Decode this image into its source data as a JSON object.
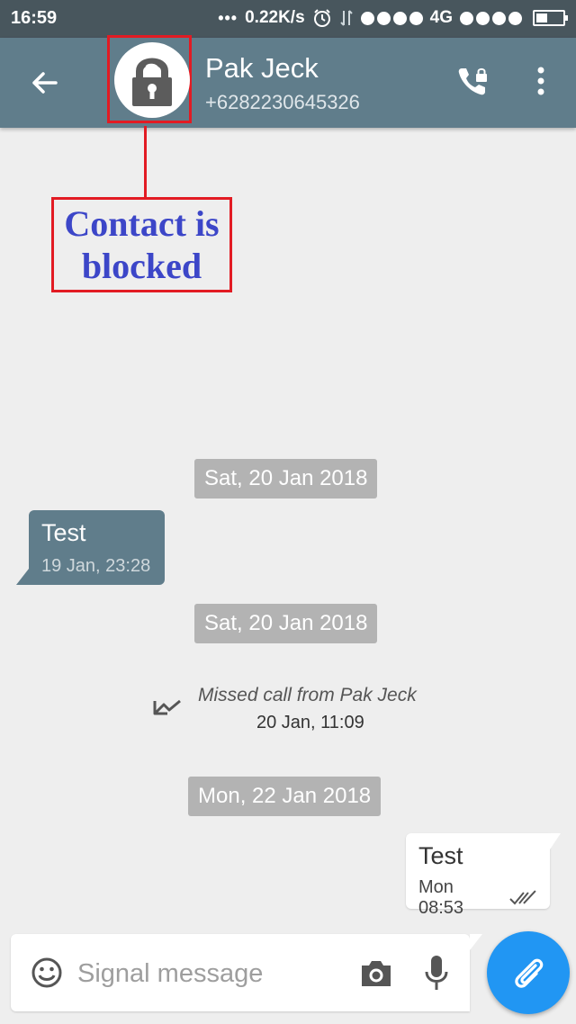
{
  "status_bar": {
    "time": "16:59",
    "network_speed": "0.22K/s",
    "network_type": "4G"
  },
  "toolbar": {
    "back_icon": "arrow-left-icon",
    "avatar_icon": "padlock-icon",
    "contact_name": "Pak Jeck",
    "contact_number": "+6282230645326",
    "call_icon": "locked-phone-icon",
    "menu_icon": "more-vertical-icon",
    "background_color": "#607d8b"
  },
  "annotation": {
    "text": "Contact is blocked",
    "border_color": "#e21b23",
    "text_color": "#3c46c8"
  },
  "conversation": {
    "date_separators": [
      "Sat, 20 Jan 2018",
      "Sat, 20 Jan 2018",
      "Mon, 22 Jan 2018"
    ],
    "incoming_message": {
      "text": "Test",
      "time": "19 Jan, 23:28"
    },
    "missed_call": {
      "text": "Missed call from Pak Jeck",
      "time": "20 Jan, 11:09",
      "icon": "missed-call-icon"
    },
    "outgoing_message": {
      "text": "Test",
      "time": "Mon 08:53",
      "status_icon": "double-check-icon"
    }
  },
  "composer": {
    "placeholder": "Signal message",
    "emoji_icon": "emoji-icon",
    "camera_icon": "camera-icon",
    "mic_icon": "mic-icon",
    "attach_icon": "paperclip-icon",
    "fab_color": "#2196f3"
  }
}
